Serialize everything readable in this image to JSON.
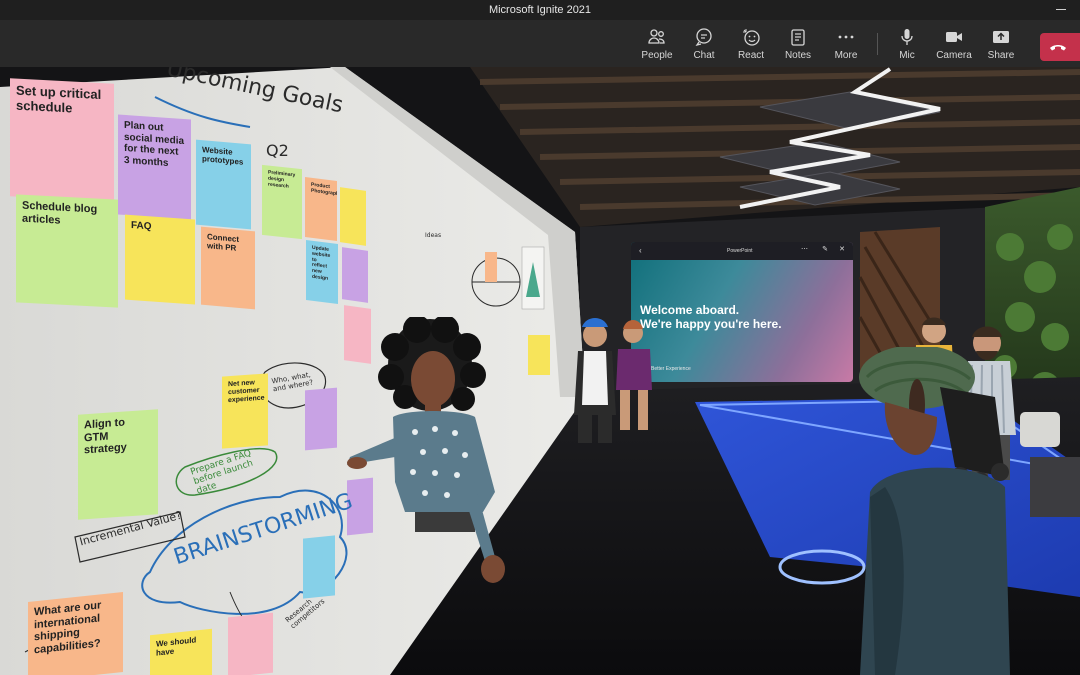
{
  "window": {
    "title": "Microsoft Ignite 2021"
  },
  "toolbar": {
    "people": "People",
    "chat": "Chat",
    "react": "React",
    "notes": "Notes",
    "more": "More",
    "mic": "Mic",
    "camera": "Camera",
    "share": "Share",
    "leave_color": "#c4314b"
  },
  "whiteboard": {
    "heading": "Upcoming Goals",
    "quarter": "Q2",
    "brainstorm": "BRAINSTORMING",
    "incremental": "Incremental Value?",
    "prepare_faq": "Prepare a FAQ before launch date",
    "who_what": "Who, what, and where?",
    "ideas": "Ideas",
    "research": "Research competitors"
  },
  "sticky_notes": {
    "setup": "Set up critical schedule",
    "social": "Plan out social media for the next 3 months",
    "website": "Website prototypes",
    "blog": "Schedule blog articles",
    "faq": "FAQ",
    "pr": "Connect with PR",
    "prelim": "Preliminary design research",
    "product_photo": "Product Photography",
    "update_site": "Update website to reflect new design",
    "align": "Align to GTM strategy",
    "net_new": "Net new customer experience",
    "international": "What are our international shipping capabilities?",
    "should_have": "We should have"
  },
  "presentation": {
    "app": "PowerPoint",
    "line1": "Welcome aboard.",
    "line2": "We're happy you're here.",
    "footer": "Better Experience"
  }
}
